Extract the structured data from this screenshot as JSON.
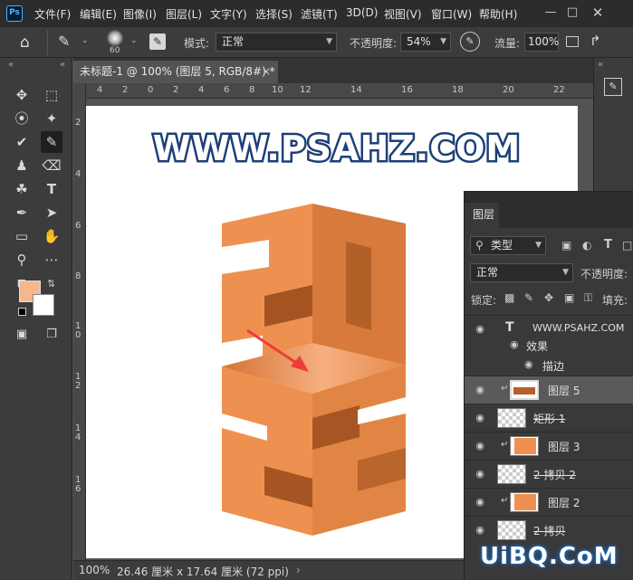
{
  "app": {
    "logo": "Ps"
  },
  "menu": [
    "文件(F)",
    "编辑(E)",
    "图像(I)",
    "图层(L)",
    "文字(Y)",
    "选择(S)",
    "滤镜(T)",
    "3D(D)",
    "视图(V)",
    "窗口(W)",
    "帮助(H)"
  ],
  "window_controls": [
    "minimize-icon",
    "restore-icon",
    "close-icon"
  ],
  "options": {
    "brush_size": "60",
    "mode_label": "模式:",
    "mode_value": "正常",
    "opacity_label": "不透明度:",
    "opacity_value": "54%",
    "flow_label": "流量:",
    "flow_value": "100%"
  },
  "document": {
    "tab_title": "未标题-1 @ 100% (图层 5, RGB/8#) *",
    "close_glyph": "×"
  },
  "ruler": {
    "h_labels": [
      "4",
      "2",
      "0",
      "2",
      "4",
      "6",
      "8",
      "10",
      "12",
      "14",
      "16",
      "18",
      "20",
      "22"
    ],
    "v_labels": [
      "2",
      "4",
      "6",
      "8",
      "1\n0",
      "1\n2",
      "1\n4",
      "1\n6"
    ]
  },
  "canvas": {
    "headline": "WWW.PSAHZ.COM",
    "top_color": "#f3a06a",
    "side_color": "#d97a3d",
    "front_color": "#ee8f4d",
    "arrow_color": "#ef3b3b"
  },
  "status": {
    "zoom": "100%",
    "doc_size": "26.46 厘米 x 17.64 厘米 (72 ppi)"
  },
  "layers_panel": {
    "tab": "图层",
    "filter_label": "类型",
    "blend_mode": "正常",
    "opacity_label": "不透明度:",
    "lock_label": "锁定:",
    "fill_label": "填充:",
    "layers": [
      {
        "name": "WWW.PSAHZ.COM",
        "kind": "text"
      },
      {
        "name": "效果",
        "kind": "effect"
      },
      {
        "name": "描边",
        "kind": "effect-item"
      },
      {
        "name": "图层 5",
        "kind": "pixel",
        "selected": true
      },
      {
        "name": "矩形 1",
        "kind": "shape"
      },
      {
        "name": "图层 3",
        "kind": "pixel"
      },
      {
        "name": "2 拷贝 2",
        "kind": "smart"
      },
      {
        "name": "图层 2",
        "kind": "pixel"
      },
      {
        "name": "2 拷贝",
        "kind": "smart"
      }
    ]
  },
  "watermark": "UiBQ.CoM"
}
